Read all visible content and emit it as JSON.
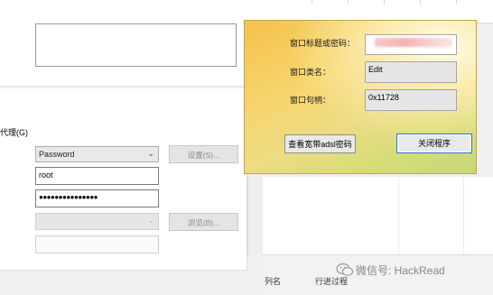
{
  "left_dialog": {
    "proxy_label": "代理(G)",
    "auth_type_select": "Password",
    "settings_button": "设置(S)...",
    "username_value": "root",
    "password_value": "●●●●●●●●●●●●●●●",
    "browse_button": "浏览(B)..."
  },
  "popup": {
    "title_label": "窗口标题或密码：",
    "class_label": "窗口类名：",
    "class_value": "Edit",
    "handle_label": "窗口句柄：",
    "handle_value": "0x11728",
    "view_button": "查看宽带adsl密码",
    "close_button": "关闭程序"
  },
  "background_window": {
    "header_fragments": [
      "列名",
      "行进过程"
    ]
  },
  "watermark": {
    "text": "微信号: HackRead"
  },
  "colors": {
    "popup_gradient_start": "#f5c24b",
    "popup_gradient_end": "#c7d87a",
    "focus_border": "#2f72c8"
  }
}
